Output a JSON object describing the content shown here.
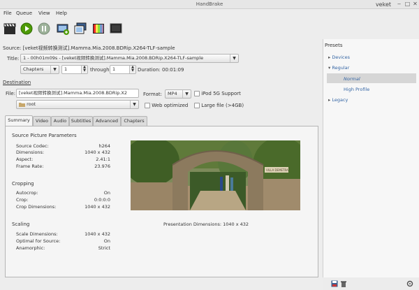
{
  "window": {
    "title": "HandBrake",
    "user": "veket"
  },
  "menu": [
    "File",
    "Queue",
    "View",
    "Help"
  ],
  "toolbar": {
    "icons": [
      "clapperboard-icon",
      "play-icon",
      "pause-icon",
      "add-queue-icon",
      "queue-icon",
      "picture-settings-icon",
      "preview-icon"
    ]
  },
  "source": {
    "label_prefix": "Source:",
    "value": "[veket视频转换测试].Mamma.Mia.2008.BDRip.X264-TLF-sample",
    "title_label": "Title:",
    "title_value": "1 - 00h01m09s - [veket视频转换测试].Mamma.Mia.2008.BDRip.X264-TLF-sample",
    "chapters_label": "Chapters",
    "chapter_start": "1",
    "through_label": "through",
    "chapter_end": "1",
    "duration_label": "Duration:",
    "duration_value": "00:01:09"
  },
  "destination": {
    "section_label": "Destination",
    "file_label": "File:",
    "file_value": "[veket视频转换测试].Mamma.Mia.2008.BDRip.X2",
    "folder_value": "root",
    "format_label": "Format:",
    "format_value": "MP4",
    "ipod_label": "iPod 5G Support",
    "web_label": "Web optimized",
    "large_label": "Large file (>4GB)"
  },
  "tabs": [
    "Summary",
    "Video",
    "Audio",
    "Subtitles",
    "Advanced",
    "Chapters"
  ],
  "summary": {
    "source_params_title": "Source Picture Parameters",
    "source_params": [
      {
        "k": "Source Codec:",
        "v": "h264"
      },
      {
        "k": "Dimensions:",
        "v": "1040 x 432"
      },
      {
        "k": "Aspect:",
        "v": "2.41:1"
      },
      {
        "k": "Frame Rate:",
        "v": "23.976"
      }
    ],
    "cropping_title": "Cropping",
    "cropping": [
      {
        "k": "Autocrop:",
        "v": "On"
      },
      {
        "k": "Crop:",
        "v": "0:0:0:0"
      },
      {
        "k": "Crop Dimensions:",
        "v": "1040 x 432"
      }
    ],
    "scaling_title": "Scaling",
    "scaling": [
      {
        "k": "Scale Dimensions:",
        "v": "1040 x 432"
      },
      {
        "k": "Optimal for Source:",
        "v": "On"
      },
      {
        "k": "Anamorphic:",
        "v": "Strict"
      }
    ],
    "presentation_label": "Presentation Dimensions: 1040 x 432",
    "preview_sign": "VILLA DEMETRA"
  },
  "presets": {
    "title": "Presets",
    "items": [
      {
        "label": "Devices",
        "type": "group"
      },
      {
        "label": "Regular",
        "type": "group-open"
      },
      {
        "label": "Normal",
        "type": "selected"
      },
      {
        "label": "High Profile",
        "type": "child"
      },
      {
        "label": "Legacy",
        "type": "group"
      }
    ]
  },
  "colors": {
    "accent": "#3465a4",
    "selection": "#d6d6d6"
  }
}
